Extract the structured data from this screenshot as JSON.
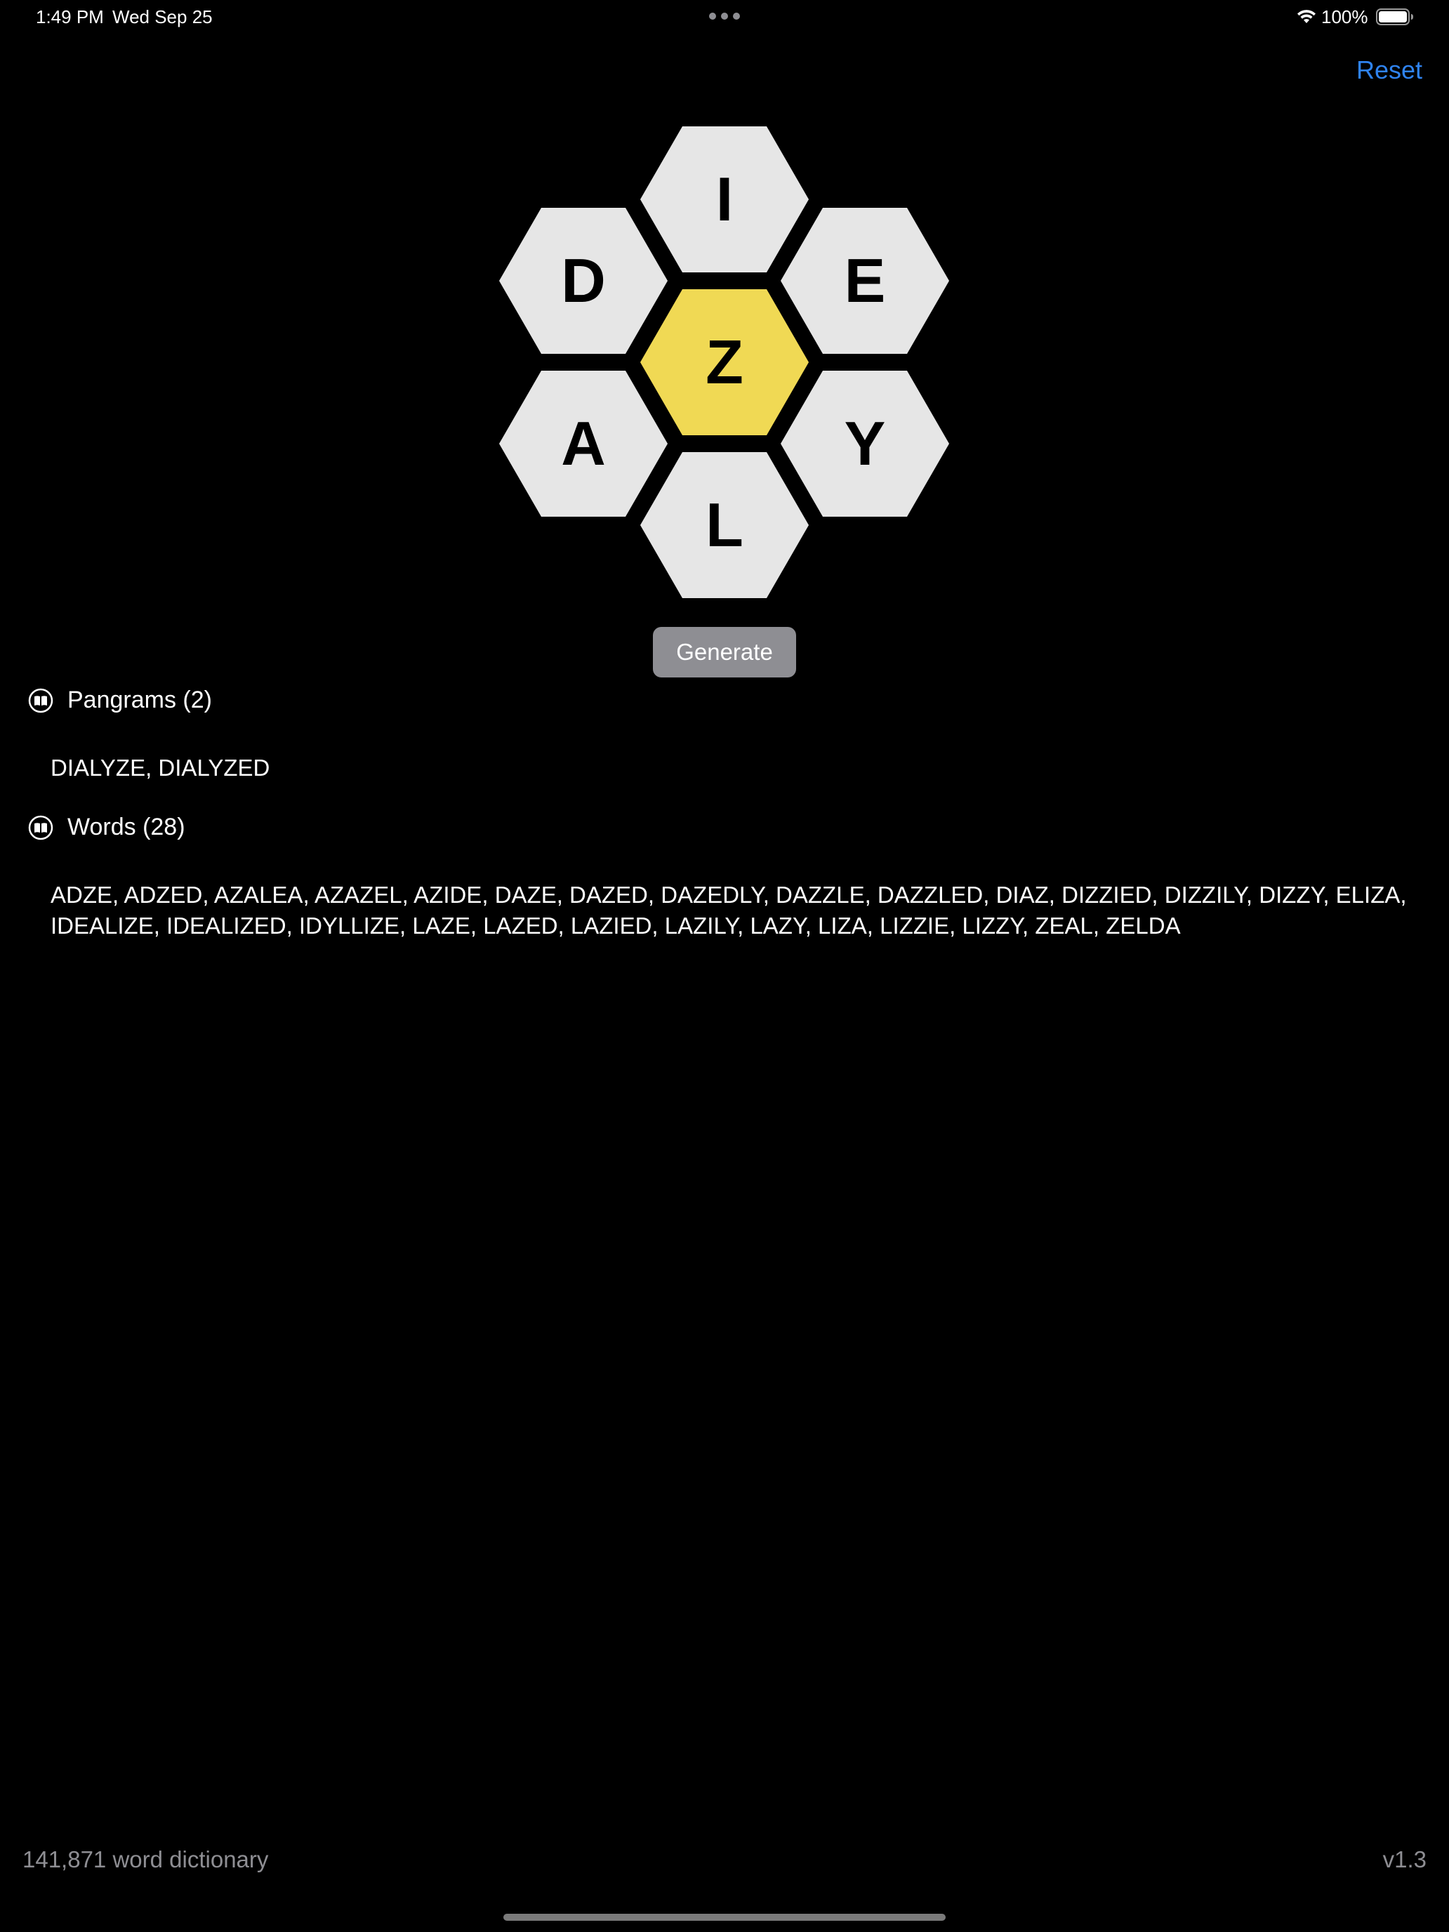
{
  "status_bar": {
    "time": "1:49 PM",
    "date": "Wed Sep 25",
    "battery_percent": "100%",
    "battery_level": 1.0,
    "icons": [
      "multitasking-dots-icon",
      "wifi-icon",
      "battery-icon"
    ]
  },
  "toolbar": {
    "reset_label": "Reset",
    "accent_color": "#2f83f0"
  },
  "puzzle": {
    "center_letter": "Z",
    "outer_letters": {
      "top": "I",
      "upper_left": "D",
      "upper_right": "E",
      "lower_left": "A",
      "lower_right": "Y",
      "bottom": "L"
    },
    "center_color": "#f0d954",
    "outer_color": "#e6e6e6",
    "generate_label": "Generate"
  },
  "pangrams": {
    "header": "Pangrams (2)",
    "icon": "book-icon",
    "text": "DIALYZE, DIALYZED"
  },
  "words": {
    "header": "Words (28)",
    "icon": "book-icon",
    "text": "ADZE, ADZED, AZALEA, AZAZEL, AZIDE, DAZE, DAZED, DAZEDLY, DAZZLE, DAZZLED, DIAZ, DIZZIED, DIZZILY, DIZZY, ELIZA, IDEALIZE, IDEALIZED, IDYLLIZE, LAZE, LAZED, LAZIED, LAZILY, LAZY, LIZA, LIZZIE, LIZZY, ZEAL, ZELDA"
  },
  "footer": {
    "dictionary": "141,871 word dictionary",
    "version": "v1.3"
  }
}
